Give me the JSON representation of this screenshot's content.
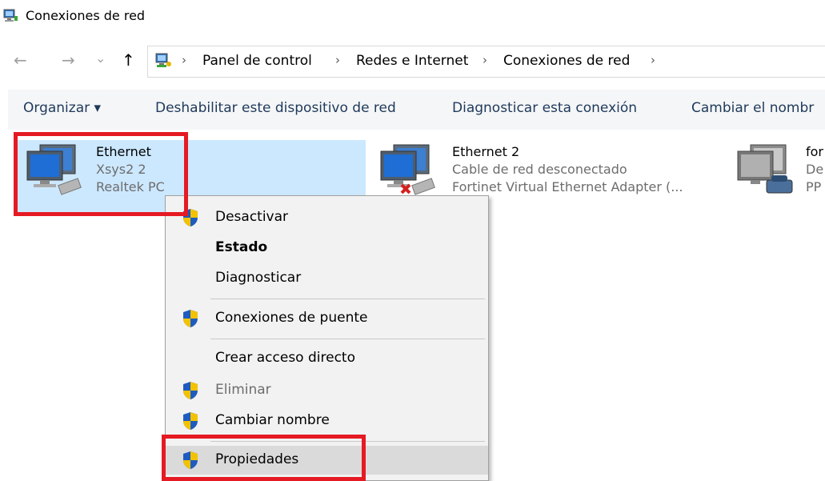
{
  "window": {
    "title": "Conexiones de red"
  },
  "nav": {
    "back": "←",
    "forward": "→",
    "recent": "⌄",
    "up": "↑"
  },
  "breadcrumb": {
    "separator": "›",
    "items": [
      "Panel de control",
      "Redes e Internet",
      "Conexiones de red"
    ]
  },
  "toolbar": {
    "organize": "Organizar ▾",
    "disable": "Deshabilitar este dispositivo de red",
    "diagnose": "Diagnosticar esta conexión",
    "rename": "Cambiar el nombr"
  },
  "connections": [
    {
      "name": "Ethernet",
      "status": "Xsys2  2",
      "device": "Realtek PC",
      "selected": true
    },
    {
      "name": "Ethernet 2",
      "status": "Cable de red desconectado",
      "device": "Fortinet Virtual Ethernet Adapter (...",
      "selected": false
    },
    {
      "name": "for",
      "status": "De",
      "device": "PP",
      "selected": false
    }
  ],
  "context_menu": {
    "items": [
      {
        "label": "Desactivar",
        "shield": true,
        "bold": false,
        "disabled": false
      },
      {
        "label": "Estado",
        "shield": false,
        "bold": true,
        "disabled": false
      },
      {
        "label": "Diagnosticar",
        "shield": false,
        "bold": false,
        "disabled": false
      },
      {
        "label": "Conexiones de puente",
        "shield": true,
        "bold": false,
        "disabled": false
      },
      {
        "label": "Crear acceso directo",
        "shield": false,
        "bold": false,
        "disabled": false
      },
      {
        "label": "Eliminar",
        "shield": true,
        "bold": false,
        "disabled": true
      },
      {
        "label": "Cambiar nombre",
        "shield": true,
        "bold": false,
        "disabled": false
      },
      {
        "label": "Propiedades",
        "shield": true,
        "bold": false,
        "disabled": false,
        "hover": true
      }
    ]
  },
  "colors": {
    "selection": "#cce8ff",
    "highlight_box": "#e51a23",
    "toolbar_text": "#1e395b",
    "menu_bg": "#f2f2f2"
  }
}
